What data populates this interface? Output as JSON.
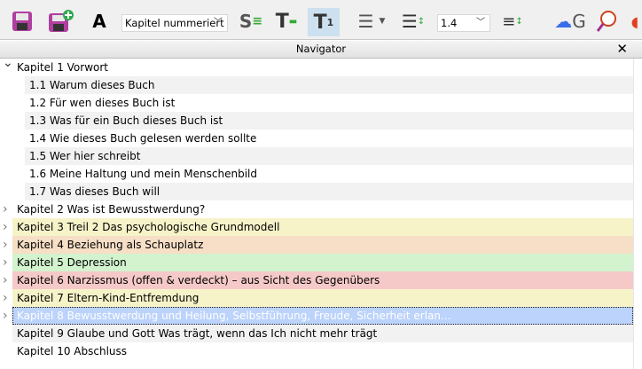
{
  "toolbar": {
    "icons": [
      "save-icon",
      "save-as-new-icon",
      "text-frame-icon",
      "heading-style-icon",
      "title-icon",
      "numbered-title-icon",
      "indent-icon",
      "line-spacing-icon",
      "paragraph-spacing-icon",
      "ghost-g-icon",
      "search-icon",
      "lips-icon"
    ],
    "style_select": "Kapitel nummeriert",
    "line_spacing_select": "1.4"
  },
  "navigator": {
    "title": "Navigator",
    "close": "✕"
  },
  "tree": [
    {
      "label": "Kapitel 1 Vorwort",
      "level": 0,
      "expanded": true,
      "color": ""
    },
    {
      "label": "1.1 Warum dieses Buch",
      "level": 1,
      "color": "#f2f2f2"
    },
    {
      "label": "1.2 Für wen dieses Buch ist",
      "level": 1,
      "color": ""
    },
    {
      "label": "1.3 Was für ein Buch dieses Buch ist",
      "level": 1,
      "color": "#f2f2f2"
    },
    {
      "label": "1.4 Wie dieses Buch gelesen werden sollte",
      "level": 1,
      "color": ""
    },
    {
      "label": "1.5 Wer hier schreibt",
      "level": 1,
      "color": "#f2f2f2"
    },
    {
      "label": "1.6 Meine Haltung und mein Menschenbild",
      "level": 1,
      "color": ""
    },
    {
      "label": "1.7 Was dieses Buch will",
      "level": 1,
      "color": "#f2f2f2"
    },
    {
      "label": "Kapitel 2 Was ist Bewusstwerdung?",
      "level": 0,
      "expanded": false,
      "color": ""
    },
    {
      "label": "Kapitel 3 Treil 2 Das psychologische Grundmodell",
      "level": 0,
      "expanded": false,
      "color": "#f7f3c9"
    },
    {
      "label": "Kapitel 4 Beziehung als Schauplatz",
      "level": 0,
      "expanded": false,
      "color": "#f6dfc6"
    },
    {
      "label": "Kapitel 5 Depression",
      "level": 0,
      "expanded": false,
      "color": "#d3f3cf"
    },
    {
      "label": "Kapitel 6 Narzissmus (offen & verdeckt) – aus Sicht des Gegenübers",
      "level": 0,
      "expanded": false,
      "color": "#f6c9c9"
    },
    {
      "label": "Kapitel 7 Eltern-Kind-Entfremdung",
      "level": 0,
      "expanded": false,
      "color": "#f7f3c9"
    },
    {
      "label": "Kapitel 8 Bewusstwerdung und Heilung, Selbstführung, Freude, Sicherheit erlan...",
      "level": 0,
      "expanded": false,
      "selected": true,
      "color": "#bcd3fb"
    },
    {
      "label": "Kapitel 9 Glaube und Gott Was trägt, wenn das Ich nicht mehr trägt",
      "level": 0,
      "color": "#f2f2f2"
    },
    {
      "label": "Kapitel 10 Abschluss",
      "level": 0,
      "color": ""
    }
  ]
}
